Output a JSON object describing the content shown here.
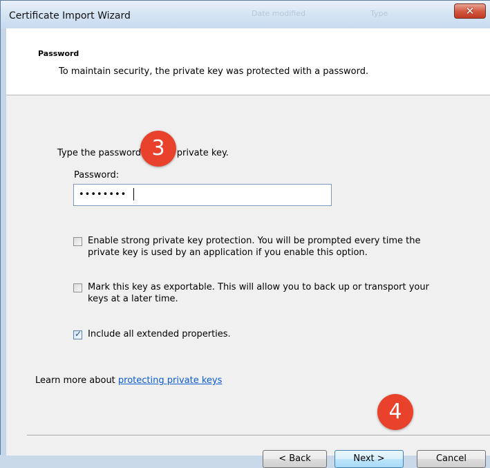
{
  "window": {
    "title": "Certificate Import Wizard",
    "close_icon": "close-icon",
    "background_text": [
      "Date modified",
      "Type"
    ]
  },
  "header": {
    "title": "Password",
    "subtitle": "To maintain security, the private key was protected with a password."
  },
  "form": {
    "prompt": "Type the password for the private key.",
    "password_label": "Password:",
    "password_value": "••••••••"
  },
  "options": [
    {
      "label_line1": "Enable strong private key protection. You will be prompted every time the",
      "label_line2": "private key is used by an application if you enable this option.",
      "checked": false
    },
    {
      "label_line1": "Mark this key as exportable. This will allow you to back up or transport your",
      "label_line2": "keys at a later time.",
      "checked": false
    },
    {
      "label_line1": "Include all extended properties.",
      "label_line2": "",
      "checked": true
    }
  ],
  "learn_more": {
    "prefix": "Learn more about ",
    "link": "protecting private keys"
  },
  "buttons": {
    "back": "< Back",
    "next": "Next >",
    "cancel": "Cancel"
  },
  "markers": {
    "step_a": "3",
    "step_b": "4",
    "color": "#e8412c"
  }
}
